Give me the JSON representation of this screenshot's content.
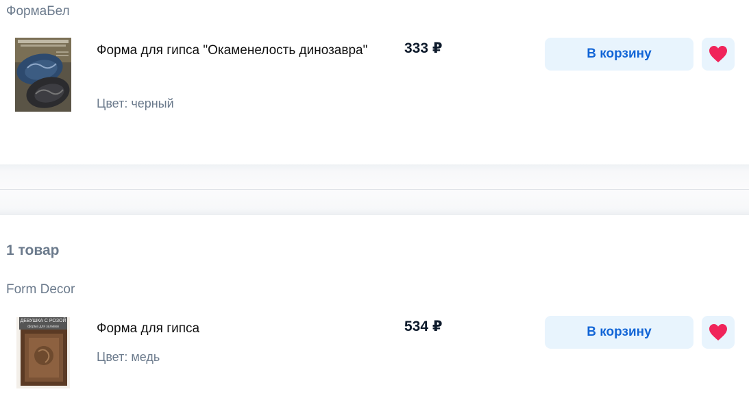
{
  "sections": [
    {
      "seller": "ФормаБел",
      "item": {
        "title": "Форма для гипса \"Окаменелость динозавра\"",
        "color": "Цвет: черный",
        "price": "333 ₽",
        "cart_label": "В корзину",
        "favorite": true,
        "image_text": "Форма для гипса \"Окаменелость динозавра\""
      }
    },
    {
      "count": "1 товар",
      "seller": "Form Decor",
      "item": {
        "title": "Форма для гипса",
        "color": "Цвет: медь",
        "price": "534 ₽",
        "cart_label": "В корзину",
        "favorite": true,
        "image_text_1": "ДЕВУШКА С РОЗОЙ",
        "image_text_2": "форма для заливки"
      }
    }
  ],
  "colors": {
    "accent": "#1265d6",
    "button_bg": "#e8f4fd",
    "heart": "#f0245a",
    "muted": "#6b7a8c"
  }
}
